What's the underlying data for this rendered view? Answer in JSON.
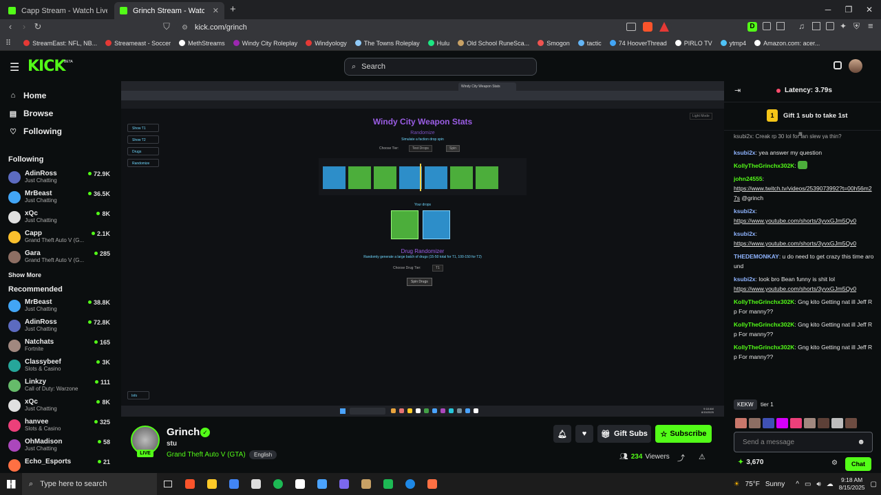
{
  "browser": {
    "tabs": [
      {
        "title": "Capp Stream - Watch Live on Kick",
        "active": false
      },
      {
        "title": "Grinch Stream - Watch Live o",
        "active": true
      }
    ],
    "new_tab": "+",
    "url": "kick.com/grinch",
    "bookmarks": [
      {
        "label": "StreamEast: NFL, NB...",
        "color": "#e53935"
      },
      {
        "label": "Streameast - Soccer",
        "color": "#e53935"
      },
      {
        "label": "MethStreams",
        "color": "#ffffff"
      },
      {
        "label": "Windy City Roleplay",
        "color": "#9c27b0"
      },
      {
        "label": "Windyology",
        "color": "#e53935"
      },
      {
        "label": "The Towns Roleplay",
        "color": "#90caf9"
      },
      {
        "label": "Hulu",
        "color": "#1ce783"
      },
      {
        "label": "Old School RuneSca...",
        "color": "#c8a165"
      },
      {
        "label": "Smogon",
        "color": "#ef5350"
      },
      {
        "label": "tactic",
        "color": "#64b5f6"
      },
      {
        "label": "74 HooverThread",
        "color": "#42a5f5"
      },
      {
        "label": "PIRLO TV",
        "color": "#ffffff"
      },
      {
        "label": "ytmp4",
        "color": "#4fc3f7"
      },
      {
        "label": "Amazon.com: acer...",
        "color": "#ffffff"
      }
    ]
  },
  "kick": {
    "logo": "KICK",
    "search_placeholder": "Search",
    "nav": [
      {
        "label": "Home",
        "icon": "home-icon"
      },
      {
        "label": "Browse",
        "icon": "browse-icon"
      },
      {
        "label": "Following",
        "icon": "heart-icon"
      }
    ],
    "following_heading": "Following",
    "following": [
      {
        "name": "AdinRoss",
        "category": "Just Chatting",
        "viewers": "72.9K",
        "color": "#5c6bc0"
      },
      {
        "name": "MrBeast",
        "category": "Just Chatting",
        "viewers": "36.5K",
        "color": "#42a5f5"
      },
      {
        "name": "xQc",
        "category": "Just Chatting",
        "viewers": "8K",
        "color": "#e0e0e0"
      },
      {
        "name": "Capp",
        "category": "Grand Theft Auto V (G...",
        "viewers": "2.1K",
        "color": "#fbc02d"
      },
      {
        "name": "Gara",
        "category": "Grand Theft Auto V (G...",
        "viewers": "285",
        "color": "#8d6e63"
      }
    ],
    "show_more": "Show More",
    "recommended_heading": "Recommended",
    "recommended": [
      {
        "name": "MrBeast",
        "category": "Just Chatting",
        "viewers": "38.8K",
        "color": "#42a5f5"
      },
      {
        "name": "AdinRoss",
        "category": "Just Chatting",
        "viewers": "72.8K",
        "color": "#5c6bc0"
      },
      {
        "name": "Natchats",
        "category": "Fortnite",
        "viewers": "165",
        "color": "#a1887f"
      },
      {
        "name": "Classybeef",
        "category": "Slots & Casino",
        "viewers": "3K",
        "color": "#26a69a"
      },
      {
        "name": "Linkzy",
        "category": "Call of Duty: Warzone",
        "viewers": "111",
        "color": "#66bb6a"
      },
      {
        "name": "xQc",
        "category": "Just Chatting",
        "viewers": "8K",
        "color": "#e0e0e0"
      },
      {
        "name": "hanvee",
        "category": "Slots & Casino",
        "viewers": "325",
        "color": "#ec407a"
      },
      {
        "name": "OhMadison",
        "category": "Just Chatting",
        "viewers": "58",
        "color": "#ab47bc"
      },
      {
        "name": "Echo_Esports",
        "category": "",
        "viewers": "21",
        "color": "#ff7043"
      }
    ]
  },
  "video": {
    "title": "Windy City Weapon Stats",
    "randomize": "Randomize",
    "simulate": "Simulate a faction drop spin",
    "choose_tier": "Choose Tier:",
    "tier_value": "Test Drops",
    "spin": "Spin",
    "your_drops": "Your drops",
    "drug_title": "Drug Randomizer",
    "drug_desc": "Randomly generate a large batch of drugs (15-50 total for T1, 100-150 for T2)",
    "drug_tier_label": "Choose Drug Tier:",
    "drug_tier_value": "T1",
    "spin_drugs": "Spin Drugs",
    "left_buttons": [
      "Show T1",
      "Show T2",
      "Drugs",
      "Randomize"
    ],
    "info": "Info",
    "light_mode": "Light Mode",
    "inner_time": "9:18 AM",
    "inner_date": "8/15/2025"
  },
  "stream": {
    "live": "LIVE",
    "name": "Grinch",
    "title": "stu",
    "category": "Grand Theft Auto V (GTA)",
    "tag": "English",
    "gift_subs": "Gift Subs",
    "subscribe": "Subscribe",
    "viewers": "234",
    "viewers_label": "Viewers"
  },
  "chat": {
    "latency": "Latency: 3.79s",
    "gift_number": "1",
    "gift_text": "Gift 1 sub to take 1st",
    "partial_top": "ksubi2x: Creak rp 30 lol for lan slew ya thin?",
    "messages": [
      {
        "user": "ksubi2x",
        "color": "b",
        "text": "yea answer my question",
        "link": ""
      },
      {
        "user": "KollyTheGrinchx302K",
        "color": "g",
        "text": "",
        "link": "",
        "emote": true
      },
      {
        "user": "john24555",
        "color": "g",
        "text": "@grinch",
        "link": "https://www.twitch.tv/videos/2539073992?t=00h56m27s"
      },
      {
        "user": "ksubi2x",
        "color": "b",
        "text": "",
        "link": "https://www.youtube.com/shorts/3yvxGJm5Qv0"
      },
      {
        "user": "ksubi2x",
        "color": "b",
        "text": "",
        "link": "https://www.youtube.com/shorts/3yvxGJm5Qv0"
      },
      {
        "user": "THEDEMONKAY",
        "color": "b",
        "text": "u do need to get crazy this time around",
        "link": ""
      },
      {
        "user": "ksubi2x",
        "color": "b",
        "text": "look bro Bean funny is shit lol",
        "link": "https://www.youtube.com/shorts/3yvxGJm5Qv0"
      },
      {
        "user": "KollyTheGrinchx302K",
        "color": "g",
        "text": "Gng kito Getting nat ill Jeff Rp For manny??",
        "link": ""
      },
      {
        "user": "KollyTheGrinchx302K",
        "color": "g",
        "text": "Gng kito Getting nat ill Jeff Rp For manny??",
        "link": ""
      },
      {
        "user": "KollyTheGrinchx302K",
        "color": "g",
        "text": "Gng kito Getting nat ill Jeff Rp For manny??",
        "link": ""
      }
    ],
    "kekw_tooltip": "KEKW",
    "partial_bottom": "tier 1",
    "input_placeholder": "Send a message",
    "points": "3,670",
    "chat_button": "Chat"
  },
  "taskbar": {
    "search_placeholder": "Type here to search",
    "weather_temp": "75°F",
    "weather_desc": "Sunny",
    "time": "9:18 AM",
    "date": "8/15/2025"
  }
}
